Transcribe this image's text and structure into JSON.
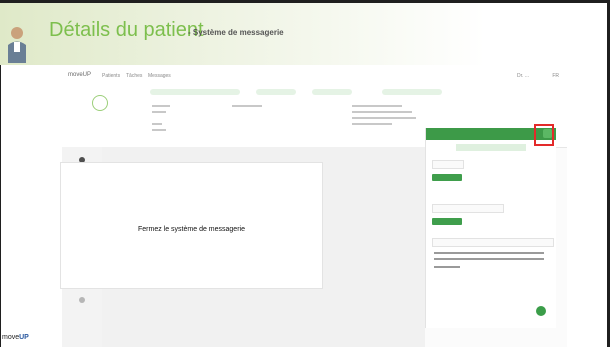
{
  "slide": {
    "title": "Détails du patient",
    "subtitle": "- Système de messagerie",
    "brand_prefix": "move",
    "brand_suffix": "UP"
  },
  "app": {
    "brand": "moveUP",
    "nav": [
      "Patients",
      "Tâches",
      "Messages"
    ],
    "user": "Dr. ...",
    "lang": "FR"
  },
  "modal": {
    "message": "Fermez le système de messagerie"
  },
  "colors": {
    "title_green": "#7dbf4d",
    "messaging_green": "#3d9a48",
    "highlight_red": "#e32a2a"
  }
}
